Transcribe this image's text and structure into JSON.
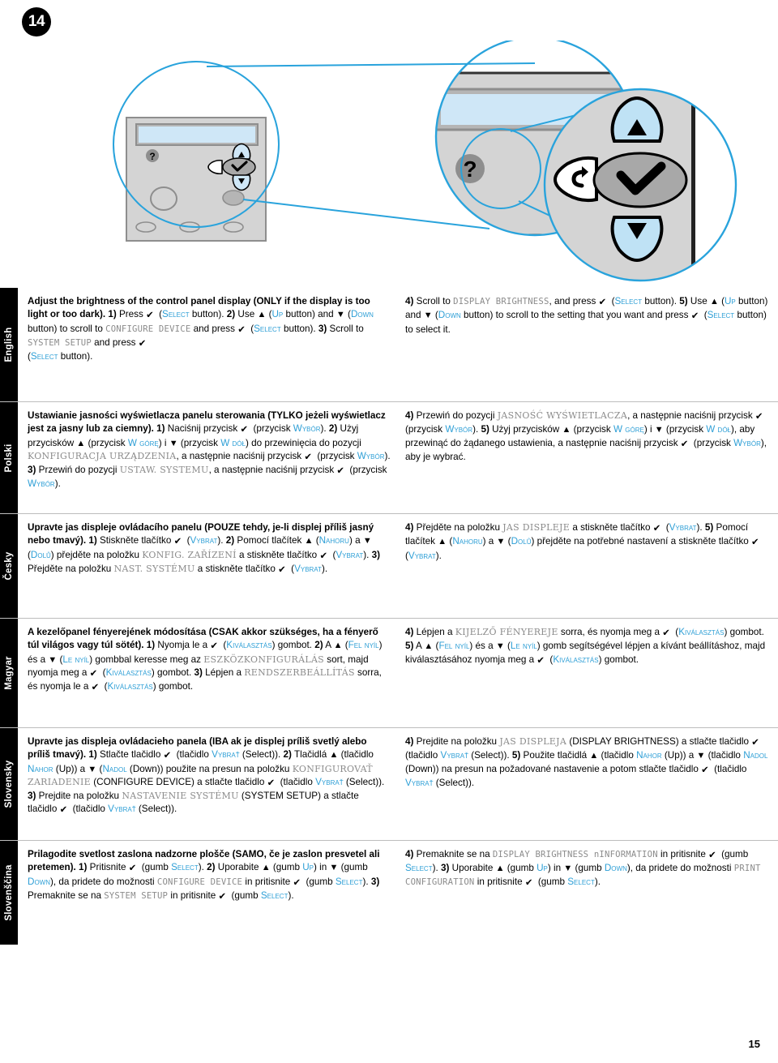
{
  "page": {
    "step_number": "14",
    "page_number": "15"
  },
  "illustration": {
    "alt_name": "control-panel-callout-diagram",
    "callout_color": "#29a3dc",
    "panel_body_color": "#d4d4d4",
    "lcd_color": "#cfe7f7",
    "button_fill_color": "#bfe2f5",
    "select_button_color": "#9e9e9e",
    "help_icon": "?",
    "up_icon": "▲",
    "down_icon": "▼",
    "back_icon": "↰",
    "select_icon": "✔"
  },
  "languages": [
    {
      "tab": "English",
      "left_html": "<b>Adjust the brightness of the control panel display (ONLY if the display is too light or too dark).</b> <b>1)</b> Press <span class=\"g-check\">✔</span>(<span class=\"blue sc\">Select</span> button). <b>2)</b> Use <span class=\"g-up\">▲</span> (<span class=\"blue sc\">Up</span> button) and <span class=\"g-down\">▼</span> (<span class=\"blue sc\">Down</span> button) to scroll to <span class=\"lcd\">CONFIGURE DEVICE</span> and press <span class=\"g-check\">✔</span>(<span class=\"blue sc\">Select</span> button). <b>3)</b> Scroll to <span class=\"lcd\">SYSTEM SETUP</span> and press <span class=\"g-check\">✔</span><br>(<span class=\"blue sc\">Select</span> button).",
      "right_html": "<b>4)</b> Scroll to <span class=\"lcd\">DISPLAY BRIGHTNESS</span>, and press <span class=\"g-check\">✔</span>(<span class=\"blue sc\">Select</span> button). <b>5)</b> Use <span class=\"g-up\">▲</span> (<span class=\"blue sc\">Up</span> button) and <span class=\"g-down\">▼</span> (<span class=\"blue sc\">Down</span> button) to scroll to the setting that you want and press <span class=\"g-check\">✔</span>(<span class=\"blue sc\">Select</span> button) to select it."
    },
    {
      "tab": "Polski",
      "left_html": "<b>Ustawianie jasności wyświetlacza panelu sterowania (TYLKO jeżeli wyświetlacz jest za jasny lub za ciemny).</b> <b>1)</b> Naciśnij przycisk <span class=\"g-check\">✔</span>(przycisk <span class=\"blue sc\">Wybór</span>). <b>2)</b> Użyj przycisków <span class=\"g-up\">▲</span> (przycisk <span class=\"blue sc\">W górę</span>) i <span class=\"g-down\">▼</span> (przycisk <span class=\"blue sc\">W dół</span>) do przewinięcia do pozycji <span class=\"lcd-serif\">KONFIGURACJA URZĄDZENIA</span>, a następnie naciśnij przycisk <span class=\"g-check\">✔</span>(przycisk <span class=\"blue sc\">Wybór</span>). <b>3)</b> Przewiń do pozycji <span class=\"lcd-serif\">USTAW. SYSTEMU</span>, a następnie naciśnij przycisk <span class=\"g-check\">✔</span>(przycisk <span class=\"blue sc\">Wybór</span>).",
      "right_html": "<b>4)</b> Przewiń do pozycji <span class=\"lcd-serif\">JASNOŚĆ WYŚWIETLACZA</span>, a następnie naciśnij przycisk <span class=\"g-check\">✔</span>(przycisk <span class=\"blue sc\">Wybór</span>). <b>5)</b> Użyj przycisków <span class=\"g-up\">▲</span> (przycisk <span class=\"blue sc\">W górę</span>) i <span class=\"g-down\">▼</span> (przycisk <span class=\"blue sc\">W dół</span>), aby przewinąć do żądanego ustawienia, a następnie naciśnij przycisk <span class=\"g-check\">✔</span>(przycisk <span class=\"blue sc\">Wybór</span>), aby je wybrać."
    },
    {
      "tab": "Česky",
      "left_html": "<b>Upravte jas displeje ovládacího panelu (POUZE tehdy, je-li displej příliš jasný nebo tmavý).</b> <b>1)</b> Stiskněte tlačítko <span class=\"g-check\">✔</span>(<span class=\"blue sc\">Vybrat</span>). <b>2)</b> Pomocí tlačítek <span class=\"g-up\">▲</span> (<span class=\"blue sc\">Nahoru</span>) a <span class=\"g-down\">▼</span> (<span class=\"blue sc\">Dolů</span>) přejděte na položku <span class=\"lcd-serif\">KONFIG. ZAŘÍZENÍ</span> a stiskněte tlačítko <span class=\"g-check\">✔</span>(<span class=\"blue sc\">Vybrat</span>). <b>3)</b> Přejděte na položku <span class=\"lcd-serif\">NAST. SYSTÉMU</span> a stiskněte tlačítko <span class=\"g-check\">✔</span>(<span class=\"blue sc\">Vybrat</span>).",
      "right_html": "<b>4)</b> Přejděte na položku <span class=\"lcd-serif\">JAS DISPLEJE</span> a stiskněte tlačítko <span class=\"g-check\">✔</span>(<span class=\"blue sc\">Vybrat</span>). <b>5)</b> Pomocí tlačítek <span class=\"g-up\">▲</span> (<span class=\"blue sc\">Nahoru</span>) a <span class=\"g-down\">▼</span> (<span class=\"blue sc\">Dolů</span>) přejděte na potřebné nastavení a stiskněte tlačítko <span class=\"g-check\">✔</span>(<span class=\"blue sc\">Vybrat</span>)."
    },
    {
      "tab": "Magyar",
      "left_html": "<b>A kezelőpanel fényerejének módosítása (CSAK akkor szükséges, ha a fényerő túl világos vagy túl sötét).</b> <b>1)</b> Nyomja le a <span class=\"g-check\">✔</span>(<span class=\"blue sc\">Kiválasztás</span>) gombot. <b>2)</b> A <span class=\"g-up\">▲</span> (<span class=\"blue sc\">Fel nyíl</span>) és a <span class=\"g-down\">▼</span> (<span class=\"blue sc\">Le nyíl</span>) gombbal keresse meg az <span class=\"lcd-serif\">ESZKÖZKONFIGURÁLÁS</span> sort, majd nyomja meg a <span class=\"g-check\">✔</span>(<span class=\"blue sc\">Kiválasztás</span>) gombot. <b>3)</b> Lépjen a <span class=\"lcd-serif\">RENDSZERBEÁLLÍTÁS</span> sorra, és nyomja le a <span class=\"g-check\">✔</span>(<span class=\"blue sc\">Kiválasztás</span>) gombot.",
      "right_html": "<b>4)</b> Lépjen a <span class=\"lcd-serif\">KIJELZŐ FÉNYEREJE</span> sorra, és nyomja meg a <span class=\"g-check\">✔</span>(<span class=\"blue sc\">Kiválasztás</span>) gombot. <b>5)</b> A <span class=\"g-up\">▲</span> (<span class=\"blue sc\">Fel nyíl</span>) és a <span class=\"g-down\">▼</span> (<span class=\"blue sc\">Le nyíl</span>) gomb segítségével lépjen a kívánt beállításhoz, majd kiválasztásához nyomja meg a <span class=\"g-check\">✔</span>(<span class=\"blue sc\">Kiválasztás</span>) gombot."
    },
    {
      "tab": "Slovensky",
      "left_html": "<b>Upravte jas displeja ovládacieho panela (IBA ak je displej príliš svetlý alebo príliš tmavý).</b> <b>1)</b> Stlačte tlačidlo <span class=\"g-check\">✔</span>(tlačidlo <span class=\"blue sc\">Vybrať</span> (Select)). <b>2)</b> Tlačidlá <span class=\"g-up\">▲</span> (tlačidlo <span class=\"blue sc\">Nahor</span> (Up)) a <span class=\"g-down\">▼</span> (<span class=\"blue sc\">Nadol</span> (Down)) použite na presun na položku <span class=\"lcd-serif\">KONFIGUROVAŤ ZARIADENIE</span> (CONFIGURE DEVICE) a stlačte tlačidlo <span class=\"g-check\">✔</span>(tlačidlo <span class=\"blue sc\">Vybrať</span> (Select)). <b>3)</b> Prejdite na položku <span class=\"lcd-serif\">NASTAVENIE SYSTÉMU</span> (SYSTEM SETUP) a stlačte tlačidlo <span class=\"g-check\">✔</span>(tlačidlo <span class=\"blue sc\">Vybrať</span> (Select)).",
      "right_html": "<b>4)</b> Prejdite na položku <span class=\"lcd-serif\">JAS DISPLEJA</span> (DISPLAY BRIGHTNESS) a stlačte tlačidlo <span class=\"g-check\">✔</span>(tlačidlo <span class=\"blue sc\">Vybrať</span> (Select)). <b>5)</b> Použite tlačidlá <span class=\"g-up\">▲</span> (tlačidlo <span class=\"blue sc\">Nahor</span> (Up)) a <span class=\"g-down\">▼</span> (tlačidlo <span class=\"blue sc\">Nadol</span> (Down)) na presun na požadované nastavenie a potom stlačte tlačidlo <span class=\"g-check\">✔</span>(tlačidlo <span class=\"blue sc\">Vybrať</span> (Select))."
    },
    {
      "tab": "Slovenščina",
      "left_html": "<b>Prilagodite svetlost zaslona nadzorne plošče (SAMO, če je zaslon presvetel ali pretemen).</b> <b>1)</b> Pritisnite <span class=\"g-check\">✔</span>(gumb <span class=\"blue sc\">Select</span>). <b>2)</b> Uporabite <span class=\"g-up\">▲</span> (gumb <span class=\"blue sc\">Up</span>) in <span class=\"g-down\">▼</span> (gumb <span class=\"blue sc\">Down</span>), da pridete do možnosti <span class=\"lcd\">CONFIGURE DEVICE</span> in pritisnite <span class=\"g-check\">✔</span>(gumb <span class=\"blue sc\">Select</span>). <b>3)</b> Premaknite se na <span class=\"lcd\">SYSTEM SETUP</span> in pritisnite <span class=\"g-check\">✔</span>(gumb <span class=\"blue sc\">Select</span>).",
      "right_html": "<b>4)</b> Premaknite se na <span class=\"lcd\">DISPLAY BRIGHTNESS n</span><span class=\"lcd\">INFORMATION</span> in pritisnite <span class=\"g-check\">✔</span>(gumb <span class=\"blue sc\">Select</span>). <b>3)</b> Uporabite <span class=\"g-up\">▲</span> (gumb <span class=\"blue sc\">Up</span>) in <span class=\"g-down\">▼</span> (gumb <span class=\"blue sc\">Down</span>), da pridete do možnosti <span class=\"lcd\">PRINT CONFIGURATION</span> in pritisnite <span class=\"g-check\">✔</span>(gumb <span class=\"blue sc\">Select</span>)."
    }
  ]
}
